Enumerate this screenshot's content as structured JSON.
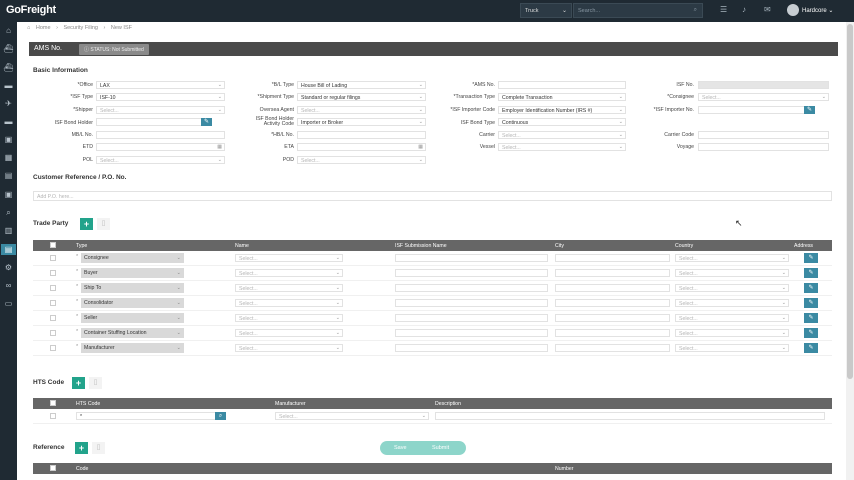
{
  "app": {
    "logo": "GoFreight",
    "mode": "Truck",
    "search_placeholder": "Search...",
    "user": "Hardcore"
  },
  "breadcrumb": [
    "Home",
    "Security Filing",
    "New ISF"
  ],
  "title": {
    "label": "AMS No.",
    "status": "STATUS: Not Submitted"
  },
  "basic": {
    "heading": "Basic Information",
    "office": {
      "label": "*Office",
      "value": "LAX"
    },
    "isf_type": {
      "label": "*ISF Type",
      "value": "ISF-10"
    },
    "shipper": {
      "label": "*Shipper",
      "placeholder": "Select..."
    },
    "isf_bond_holder": {
      "label": "ISF Bond Holder"
    },
    "mbl": {
      "label": "MB/L No."
    },
    "etd": {
      "label": "ETD"
    },
    "pol": {
      "label": "POL",
      "placeholder": "Select..."
    },
    "bl_type": {
      "label": "*B/L Type",
      "value": "House Bill of Lading"
    },
    "shipment_type": {
      "label": "*Shipment Type",
      "value": "Standard or regular filings"
    },
    "oversea_agent": {
      "label": "Oversea Agent",
      "placeholder": "Select..."
    },
    "bond_activity": {
      "label_line1": "ISF Bond Holder",
      "label_line2": "Activity Code",
      "value": "Importer or Broker"
    },
    "hbl": {
      "label": "*HB/L No."
    },
    "eta": {
      "label": "ETA"
    },
    "pod": {
      "label": "POD",
      "placeholder": "Select..."
    },
    "ams_no": {
      "label": "*AMS No."
    },
    "transaction_type": {
      "label": "*Transaction Type",
      "value": "Complete Transaction"
    },
    "importer_code": {
      "label": "*ISF Importer Code",
      "value": "Employer Identification Number (IRS #)"
    },
    "bond_type": {
      "label": "ISF Bond Type",
      "value": "Continuous"
    },
    "carrier": {
      "label": "Carrier",
      "placeholder": "Select..."
    },
    "vessel": {
      "label": "Vessel",
      "placeholder": "Select..."
    },
    "isf_no": {
      "label": "ISF No."
    },
    "consignee": {
      "label": "*Consignee",
      "placeholder": "Select..."
    },
    "importer_no": {
      "label": "*ISF Importer No."
    },
    "carrier_code": {
      "label": "Carrier Code"
    },
    "voyage": {
      "label": "Voyage"
    }
  },
  "customer_ref": {
    "heading": "Customer Reference / P.O. No.",
    "placeholder": "Add P.O. here..."
  },
  "trade_party": {
    "heading": "Trade Party",
    "columns": [
      "Type",
      "Name",
      "ISF Submission Name",
      "City",
      "Country",
      "Address"
    ],
    "select_placeholder": "Select...",
    "rows": [
      "Consignee",
      "Buyer",
      "Ship To",
      "Consolidator",
      "Seller",
      "Container Stuffing Location",
      "Manufacturer"
    ]
  },
  "hts": {
    "heading": "HTS Code",
    "columns": [
      "HTS Code",
      "Manufacturer",
      "Description"
    ],
    "select_placeholder": "Select..."
  },
  "reference": {
    "heading": "Reference",
    "columns": [
      "Code",
      "Number"
    ]
  },
  "actions": {
    "save": "Save",
    "submit": "Submit"
  },
  "colors": {
    "accent": "#22a38b",
    "edit": "#3b8aa3",
    "sidebar": "#1f2a33"
  }
}
